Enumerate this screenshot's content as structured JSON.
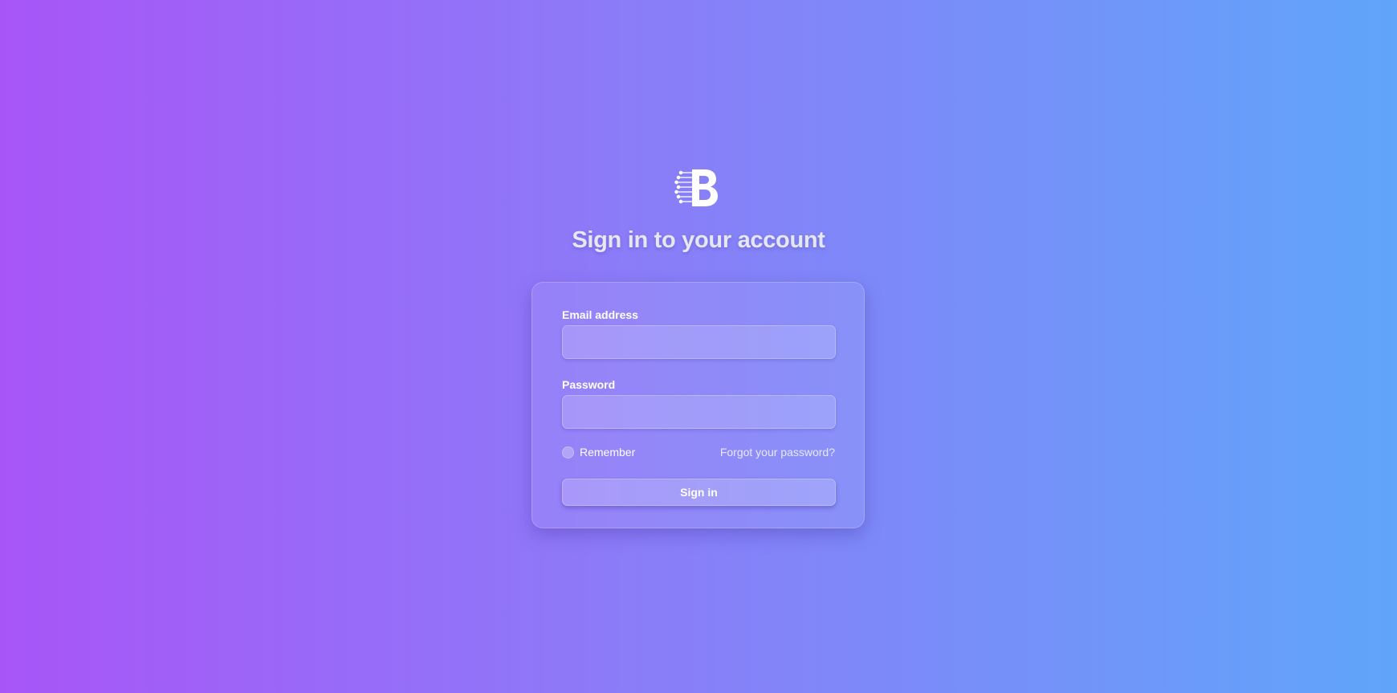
{
  "app": {
    "logo_icon": "b-circuit-logo",
    "title": "Sign in to your account"
  },
  "form": {
    "email_label": "Email address",
    "email_value": "",
    "password_label": "Password",
    "password_value": "",
    "remember_label": "Remember",
    "forgot_link": "Forgot your password?",
    "submit_label": "Sign in"
  },
  "colors": {
    "gradient_start": "#a855f7",
    "gradient_mid": "#8b7cf8",
    "gradient_end": "#60a5fa",
    "text": "#ffffff"
  }
}
